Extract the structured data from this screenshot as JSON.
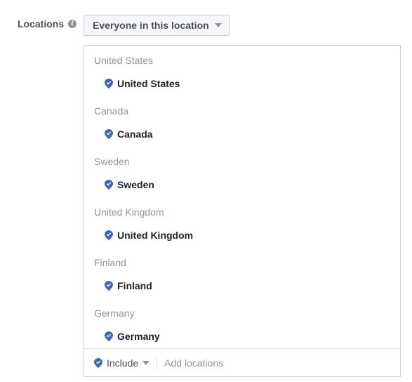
{
  "field": {
    "label": "Locations",
    "info_icon": "info-icon",
    "audience_dropdown": "Everyone in this location"
  },
  "locations": [
    {
      "header": "United States",
      "item": "United States"
    },
    {
      "header": "Canada",
      "item": "Canada"
    },
    {
      "header": "Sweden",
      "item": "Sweden"
    },
    {
      "header": "United Kingdom",
      "item": "United Kingdom"
    },
    {
      "header": "Finland",
      "item": "Finland"
    },
    {
      "header": "Germany",
      "item": "Germany"
    }
  ],
  "footer": {
    "include_label": "Include",
    "add_placeholder": "Add locations"
  },
  "colors": {
    "pin": "#4267b2",
    "header_text": "#90949c",
    "item_text": "#1d2129"
  }
}
